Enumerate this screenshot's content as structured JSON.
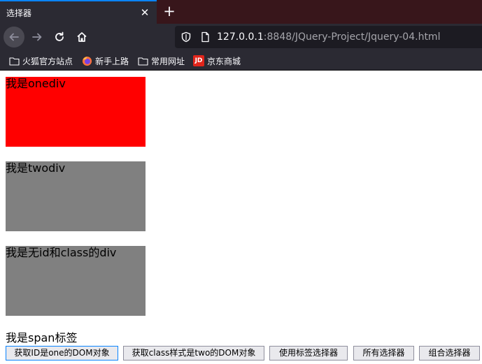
{
  "browser": {
    "tab_title": "选择器",
    "tab_close": "✕",
    "new_tab": "+",
    "url_host": "127.0.0.1",
    "url_path": ":8848/JQuery-Project/Jquery-04.html",
    "bookmarks": [
      {
        "label": "火狐官方站点",
        "icon": "folder-icon"
      },
      {
        "label": "新手上路",
        "icon": "firefox-icon"
      },
      {
        "label": "常用网址",
        "icon": "folder-icon"
      },
      {
        "label": "京东商城",
        "icon": "jd-icon",
        "icon_text": "JD"
      }
    ]
  },
  "page": {
    "div_one": "我是onediv",
    "div_two": "我是twodiv",
    "div_plain": "我是无id和class的div",
    "span_text": "我是span标签",
    "buttons": [
      "获取ID是one的DOM对象",
      "获取class样式是two的DOM对象",
      "使用标签选择器",
      "所有选择器",
      "组合选择器"
    ]
  },
  "colors": {
    "div_one_bg": "#ff0000",
    "div_two_bg": "#808080",
    "div_plain_bg": "#808080",
    "chrome_bg": "#2b2a33",
    "tabstrip_bg": "#38161b"
  }
}
